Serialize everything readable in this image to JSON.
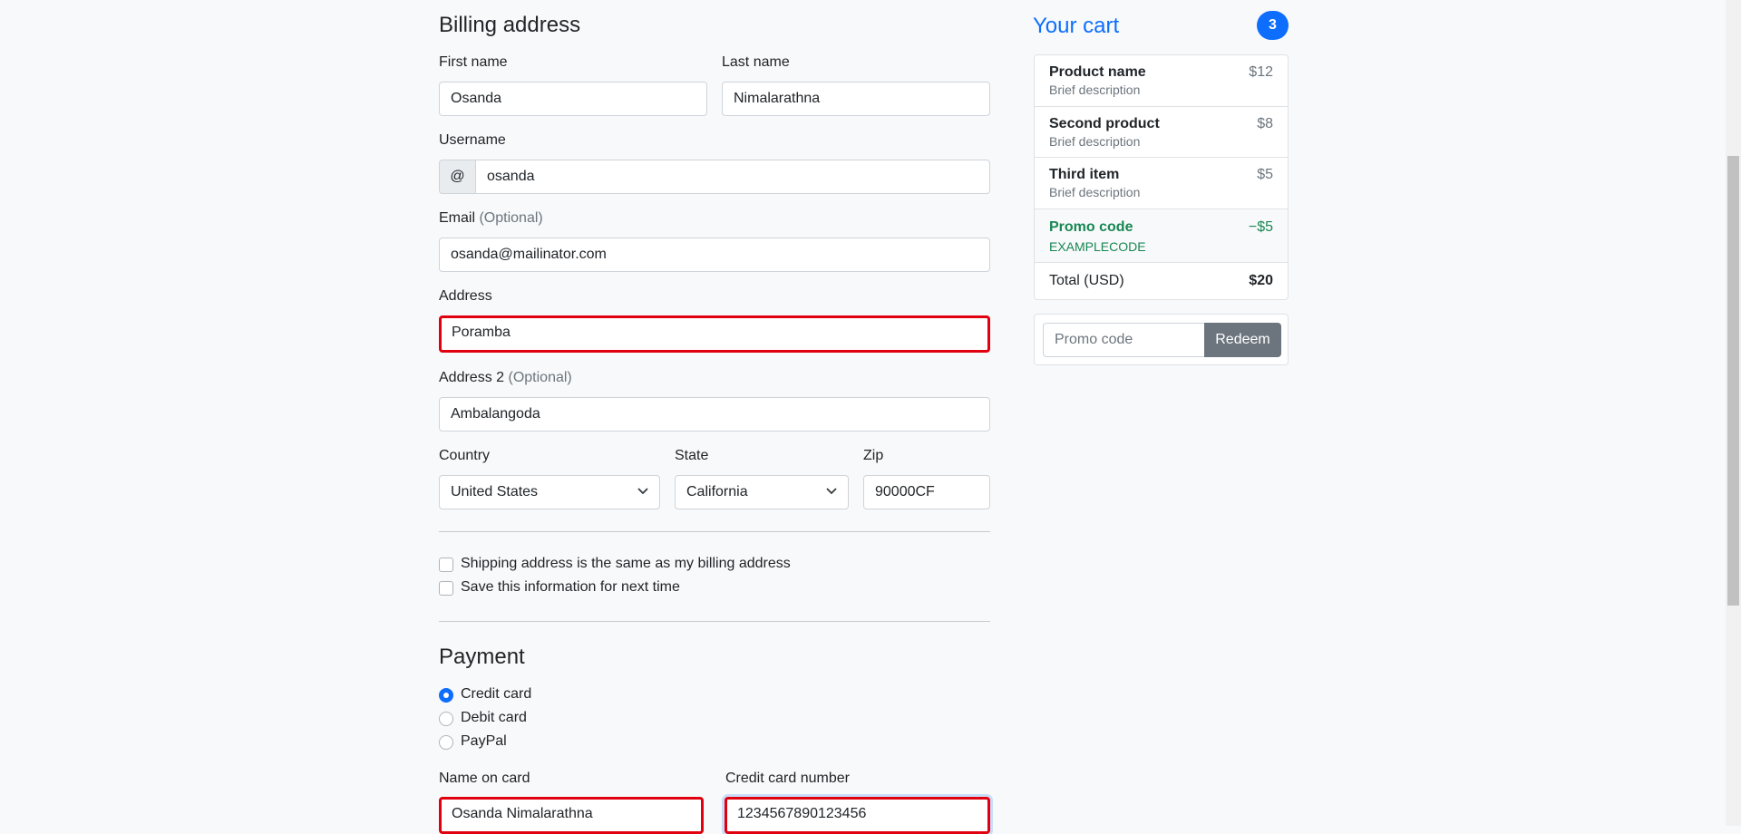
{
  "billing": {
    "heading": "Billing address",
    "first_name": {
      "label": "First name",
      "value": "Osanda"
    },
    "last_name": {
      "label": "Last name",
      "value": "Nimalarathna"
    },
    "username": {
      "label": "Username",
      "prefix": "@",
      "value": "osanda"
    },
    "email": {
      "label": "Email",
      "optional": "(Optional)",
      "value": "osanda@mailinator.com"
    },
    "address": {
      "label": "Address",
      "value": "Poramba"
    },
    "address2": {
      "label": "Address 2",
      "optional": "(Optional)",
      "value": "Ambalangoda"
    },
    "country": {
      "label": "Country",
      "value": "United States"
    },
    "state": {
      "label": "State",
      "value": "California"
    },
    "zip": {
      "label": "Zip",
      "value": "90000CF"
    },
    "same_address": "Shipping address is the same as my billing address",
    "save_info": "Save this information for next time"
  },
  "payment": {
    "heading": "Payment",
    "methods": [
      "Credit card",
      "Debit card",
      "PayPal"
    ],
    "selected": "Credit card",
    "name_on_card": {
      "label": "Name on card",
      "value": "Osanda Nimalarathna"
    },
    "card_number": {
      "label": "Credit card number",
      "value": "1234567890123456"
    }
  },
  "cart": {
    "heading": "Your cart",
    "count": "3",
    "items": [
      {
        "name": "Product name",
        "desc": "Brief description",
        "price": "$12"
      },
      {
        "name": "Second product",
        "desc": "Brief description",
        "price": "$8"
      },
      {
        "name": "Third item",
        "desc": "Brief description",
        "price": "$5"
      }
    ],
    "promo": {
      "name": "Promo code",
      "code": "EXAMPLECODE",
      "amount": "−$5"
    },
    "total_label": "Total (USD)",
    "total_value": "$20",
    "promo_placeholder": "Promo code",
    "redeem_label": "Redeem"
  },
  "colors": {
    "primary": "#0d6efd",
    "success": "#198754",
    "error_border": "#e0000f",
    "secondary": "#6c757d"
  }
}
